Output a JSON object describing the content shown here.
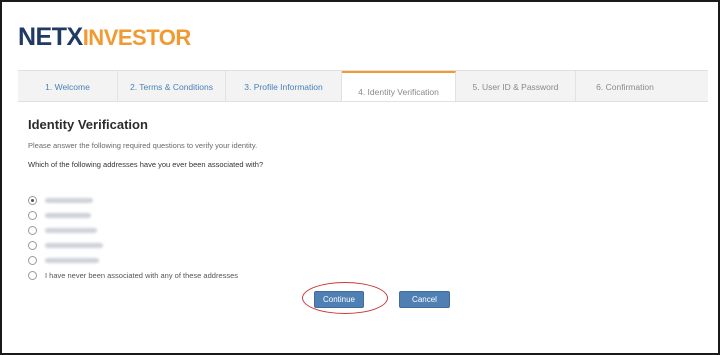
{
  "logo": {
    "part1": "NETX",
    "part2": "INVESTOR"
  },
  "wizard": {
    "steps": [
      {
        "label": "1. Welcome"
      },
      {
        "label": "2. Terms & Conditions"
      },
      {
        "label": "3. Profile Information"
      },
      {
        "label": "4. Identity Verification",
        "active": true
      },
      {
        "label": "5. User ID & Password"
      },
      {
        "label": "6. Confirmation"
      }
    ]
  },
  "form": {
    "title": "Identity Verification",
    "instructions": "Please answer the following required questions to verify your identity.",
    "question": "Which of the following addresses have you ever been associated with?",
    "none_option": "I have never been associated with any of these addresses"
  },
  "buttons": {
    "continue": "Continue",
    "cancel": "Cancel"
  },
  "colors": {
    "brand_dark": "#1f3a63",
    "brand_accent": "#f29a32",
    "button": "#4f7fb3",
    "highlight": "#c83a3a"
  }
}
